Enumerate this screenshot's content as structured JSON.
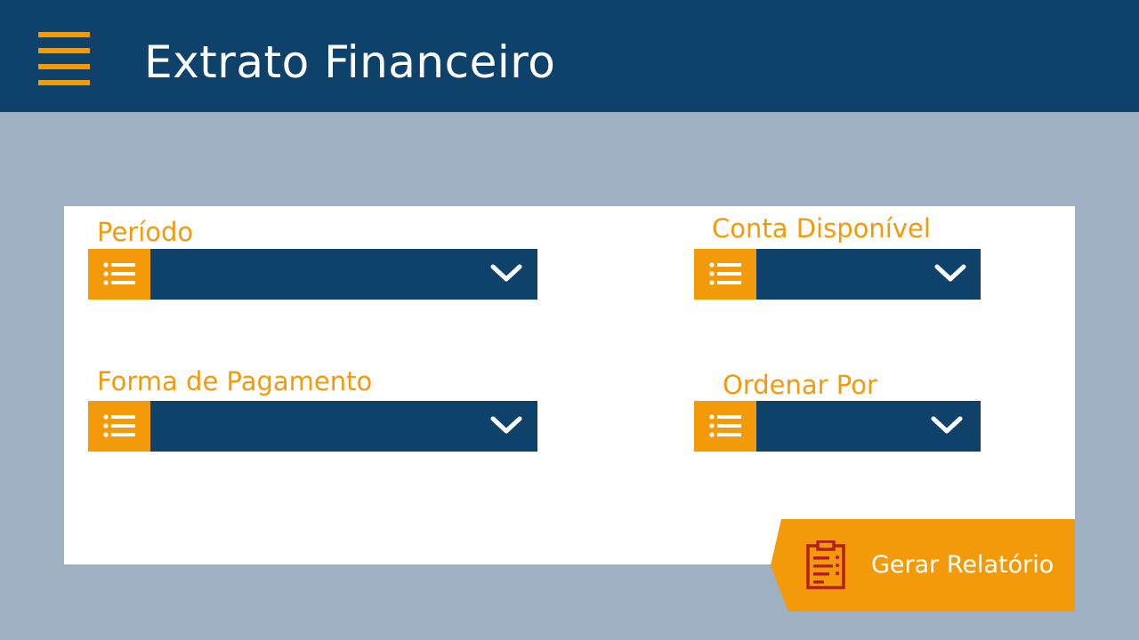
{
  "header": {
    "title": "Extrato Financeiro",
    "menu_icon": "hamburger-menu-icon"
  },
  "filters": {
    "periodo": {
      "label": "Período",
      "value": ""
    },
    "conta": {
      "label": "Conta Disponível",
      "value": ""
    },
    "pagamento": {
      "label": "Forma de Pagamento",
      "value": ""
    },
    "ordenar": {
      "label": "Ordenar Por",
      "value": ""
    }
  },
  "actions": {
    "generate_label": "Gerar Relatório",
    "generate_icon": "clipboard-report-icon"
  },
  "colors": {
    "navy": "#0e426b",
    "orange": "#f39a0b",
    "background": "#9db1c3",
    "panel": "#ffffff"
  }
}
